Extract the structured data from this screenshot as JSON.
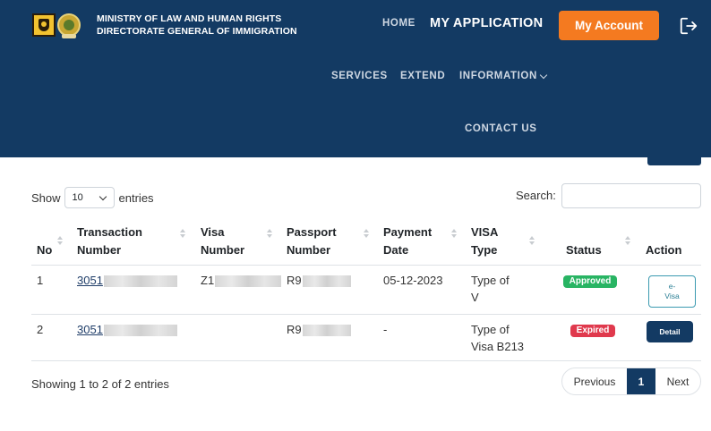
{
  "header": {
    "ministry_line1": "MINISTRY OF  LAW  AND HUMAN RIGHTS",
    "ministry_line2": "DIRECTORATE GENERAL OF IMMIGRATION",
    "nav": {
      "home": "HOME",
      "my_application": "MY APPLICATION",
      "account_button": "My Account",
      "services": "SERVICES",
      "extend": "EXTEND",
      "information": "INFORMATION",
      "contact_us": "CONTACT US"
    },
    "colors": {
      "brand": "#133a63",
      "accent": "#f47a20"
    }
  },
  "controls": {
    "show_label": "Show",
    "page_size": "10",
    "entries_label": "entries",
    "search_label": "Search:",
    "search_value": ""
  },
  "table": {
    "headers": {
      "no": "No",
      "transaction_line1": "Transaction",
      "transaction_line2": "Number",
      "visa_line1": "Visa",
      "visa_line2": "Number",
      "passport_line1": "Passport",
      "passport_line2": "Number",
      "payment_line1": "Payment",
      "payment_line2": "Date",
      "visa_type_line1": "VISA",
      "visa_type_line2": "Type",
      "status": "Status",
      "action": "Action"
    },
    "rows": [
      {
        "no": "1",
        "transaction": "3051",
        "visa": "Z1",
        "passport": "R9",
        "payment_date": "05-12-2023",
        "visa_type_line1": "Type of",
        "visa_type_line2": "V",
        "status": "Approved",
        "action_line1": "e-",
        "action_line2": "Visa"
      },
      {
        "no": "2",
        "transaction": "3051",
        "visa": "",
        "passport": "R9",
        "payment_date": "-",
        "visa_type_line1": "Type of",
        "visa_type_line2": "Visa B213",
        "status": "Expired",
        "action": "Detail"
      }
    ],
    "status_colors": {
      "approved": "#28b463",
      "expired": "#e0394d"
    }
  },
  "footer": {
    "showing": "Showing 1 to 2 of 2 entries",
    "previous": "Previous",
    "current_page": "1",
    "next": "Next"
  }
}
